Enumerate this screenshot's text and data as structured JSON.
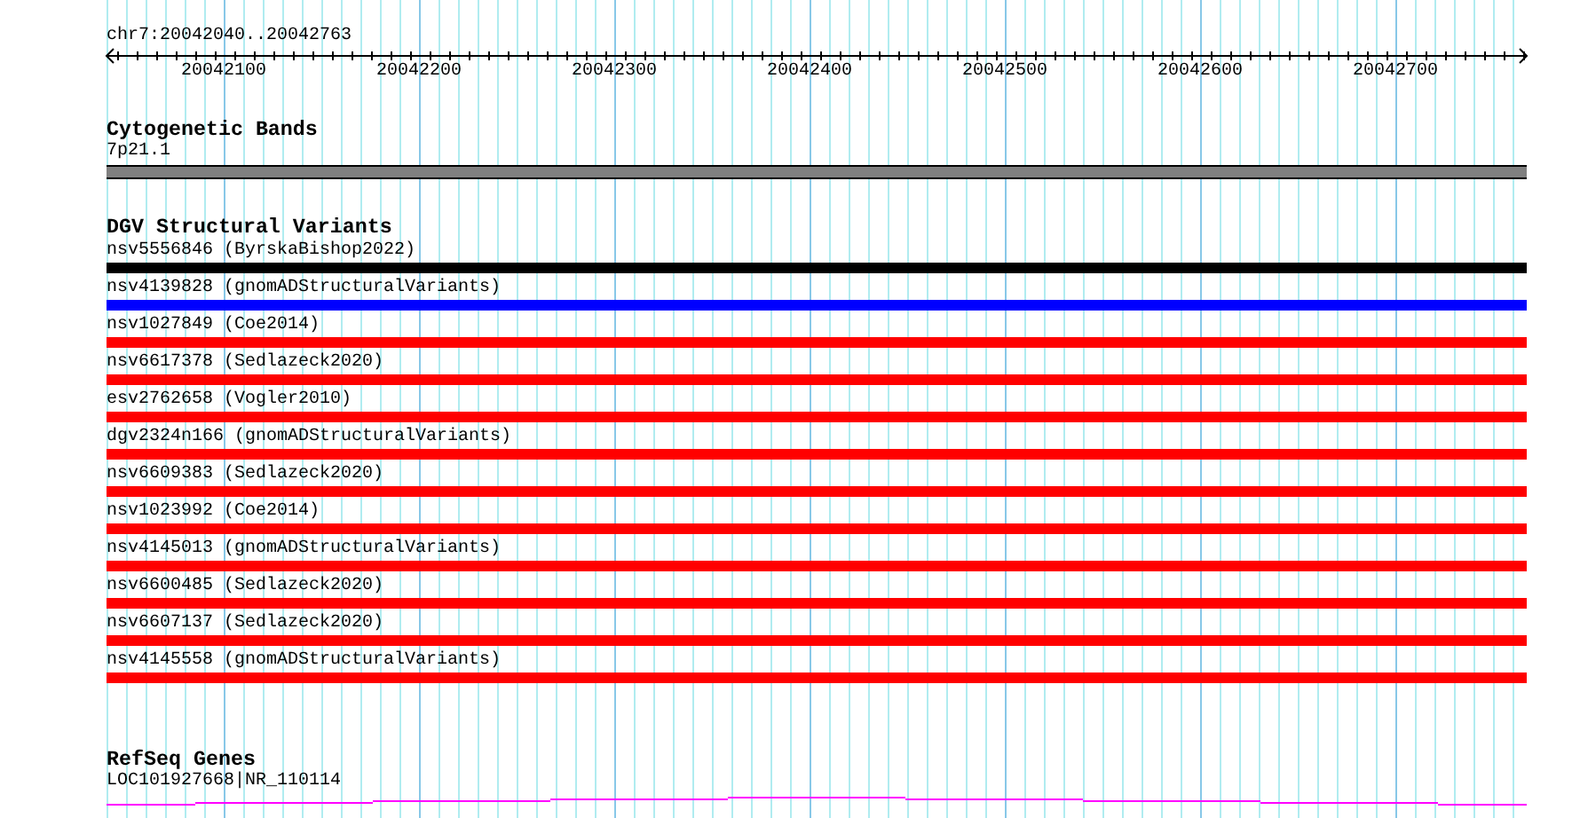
{
  "ruler": {
    "range": "chr7:20042040..20042763",
    "ticks": [
      "20042100",
      "20042200",
      "20042300",
      "20042400",
      "20042500",
      "20042600",
      "20042700"
    ]
  },
  "cytogenetic_bands": {
    "title": "Cytogenetic Bands",
    "band": "7p21.1"
  },
  "dgv_structural_variants": {
    "title": "DGV Structural Variants",
    "variants": [
      {
        "label": "nsv5556846 (ByrskaBishop2022)",
        "color": "#000000"
      },
      {
        "label": "nsv4139828 (gnomADStructuralVariants)",
        "color": "#0000ff"
      },
      {
        "label": "nsv1027849 (Coe2014)",
        "color": "#ff0000"
      },
      {
        "label": "nsv6617378 (Sedlazeck2020)",
        "color": "#ff0000"
      },
      {
        "label": "esv2762658 (Vogler2010)",
        "color": "#ff0000"
      },
      {
        "label": "dgv2324n166 (gnomADStructuralVariants)",
        "color": "#ff0000"
      },
      {
        "label": "nsv6609383 (Sedlazeck2020)",
        "color": "#ff0000"
      },
      {
        "label": "nsv1023992 (Coe2014)",
        "color": "#ff0000"
      },
      {
        "label": "nsv4145013 (gnomADStructuralVariants)",
        "color": "#ff0000"
      },
      {
        "label": "nsv6600485 (Sedlazeck2020)",
        "color": "#ff0000"
      },
      {
        "label": "nsv6607137 (Sedlazeck2020)",
        "color": "#ff0000"
      },
      {
        "label": "nsv4145558 (gnomADStructuralVariants)",
        "color": "#ff0000"
      }
    ]
  },
  "refseq_genes": {
    "title": "RefSeq Genes",
    "gene": "LOC101927668|NR_110114"
  }
}
